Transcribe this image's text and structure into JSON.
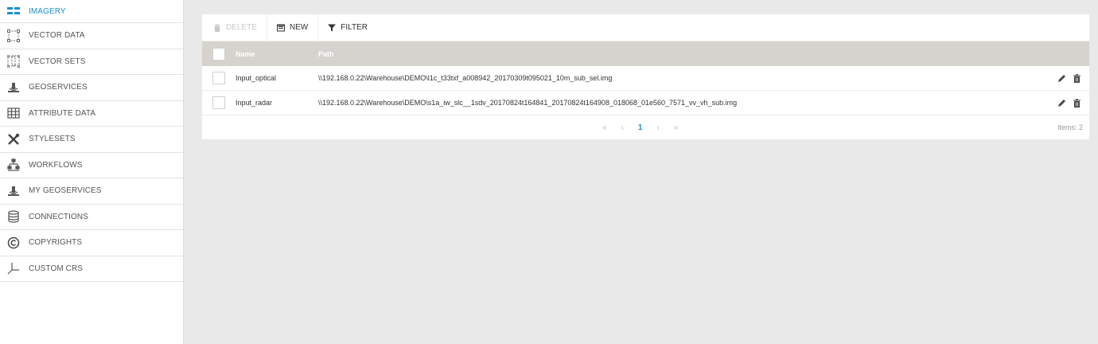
{
  "sidebar": {
    "items": [
      {
        "label": "IMAGERY",
        "icon": "imagery-icon",
        "active": true
      },
      {
        "label": "VECTOR DATA",
        "icon": "vector-data-icon"
      },
      {
        "label": "VECTOR SETS",
        "icon": "vector-sets-icon"
      },
      {
        "label": "GEOSERVICES",
        "icon": "geoservices-icon"
      },
      {
        "label": "ATTRIBUTE DATA",
        "icon": "table-icon"
      },
      {
        "label": "STYLESETS",
        "icon": "tools-icon"
      },
      {
        "label": "WORKFLOWS",
        "icon": "workflow-icon"
      },
      {
        "label": "MY GEOSERVICES",
        "icon": "geoservices-icon"
      },
      {
        "label": "CONNECTIONS",
        "icon": "database-icon"
      },
      {
        "label": "COPYRIGHTS",
        "icon": "copyright-icon"
      },
      {
        "label": "CUSTOM CRS",
        "icon": "axes-icon"
      }
    ]
  },
  "toolbar": {
    "delete_label": "DELETE",
    "new_label": "NEW",
    "filter_label": "FILTER"
  },
  "grid": {
    "columns": {
      "name": "Name",
      "path": "Path"
    },
    "rows": [
      {
        "name": "Input_optical",
        "path": "\\\\192.168.0.22\\Warehouse\\DEMO\\l1c_t33txf_a008942_20170309t095021_10m_sub_sel.img"
      },
      {
        "name": "Input_radar",
        "path": "\\\\192.168.0.22\\Warehouse\\DEMO\\s1a_iw_slc__1sdv_20170824t164841_20170824t164908_018068_01e560_7571_vv_vh_sub.img"
      }
    ]
  },
  "pager": {
    "first": "«",
    "prev": "‹",
    "current": "1",
    "next": "›",
    "last": "»",
    "items_text": "Items: 2"
  },
  "colors": {
    "accent": "#1a8fd1",
    "header_bg": "#d6d2ce",
    "page_bg": "#e9e9e9"
  }
}
